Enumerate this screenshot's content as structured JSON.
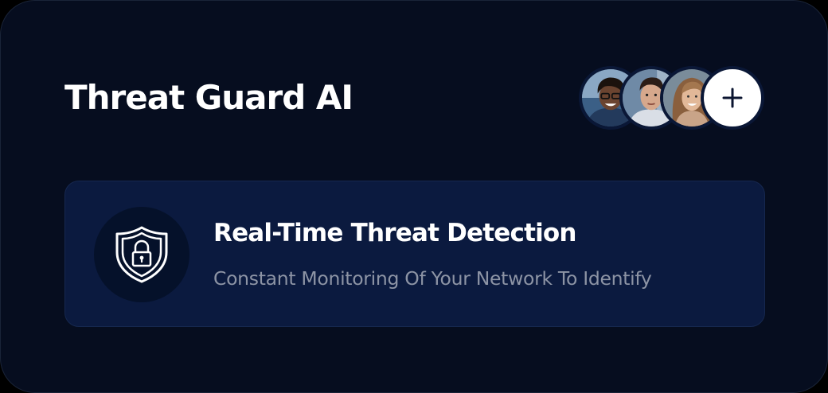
{
  "app": {
    "title": "Threat Guard AI"
  },
  "team": {
    "avatars": [
      {
        "icon": "person-avatar-1"
      },
      {
        "icon": "person-avatar-2"
      },
      {
        "icon": "person-avatar-3"
      }
    ],
    "add_icon": "plus-icon"
  },
  "feature": {
    "icon": "shield-lock-icon",
    "title": "Real-Time Threat Detection",
    "description": "Constant Monitoring Of Your Network To Identify"
  },
  "colors": {
    "background": "#060d1f",
    "feature_card": "#0b1a3f",
    "accent_white": "#ffffff",
    "muted_text": "#8d94a5"
  }
}
